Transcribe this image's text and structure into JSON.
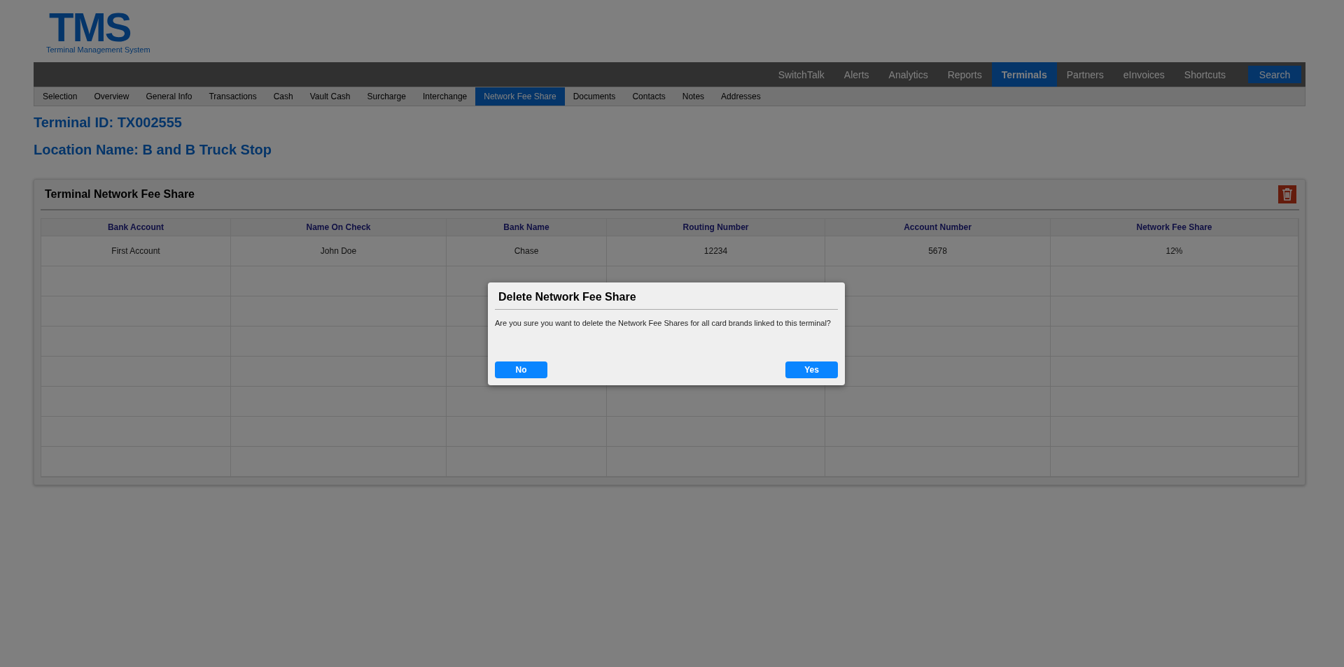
{
  "logo": {
    "mark": "TMS",
    "tagline": "Terminal Management System"
  },
  "main_nav": [
    {
      "label": "SwitchTalk",
      "selected": false
    },
    {
      "label": "Alerts",
      "selected": false
    },
    {
      "label": "Analytics",
      "selected": false
    },
    {
      "label": "Reports",
      "selected": false
    },
    {
      "label": "Terminals",
      "selected": true
    },
    {
      "label": "Partners",
      "selected": false
    },
    {
      "label": "eInvoices",
      "selected": false
    },
    {
      "label": "Shortcuts",
      "selected": false
    }
  ],
  "search_button": "Search",
  "sub_nav": [
    {
      "label": "Selection",
      "selected": false
    },
    {
      "label": "Overview",
      "selected": false
    },
    {
      "label": "General Info",
      "selected": false
    },
    {
      "label": "Transactions",
      "selected": false
    },
    {
      "label": "Cash",
      "selected": false
    },
    {
      "label": "Vault Cash",
      "selected": false
    },
    {
      "label": "Surcharge",
      "selected": false
    },
    {
      "label": "Interchange",
      "selected": false
    },
    {
      "label": "Network Fee Share",
      "selected": true
    },
    {
      "label": "Documents",
      "selected": false
    },
    {
      "label": "Contacts",
      "selected": false
    },
    {
      "label": "Notes",
      "selected": false
    },
    {
      "label": "Addresses",
      "selected": false
    }
  ],
  "terminal_id": "Terminal ID: TX002555",
  "location_name": "Location Name: B and B Truck Stop",
  "panel": {
    "title": "Terminal Network Fee Share",
    "table": {
      "columns": [
        "Bank Account",
        "Name On Check",
        "Bank Name",
        "Routing Number",
        "Account Number",
        "Network Fee Share"
      ],
      "rows": [
        [
          "First Account",
          "John Doe",
          "Chase",
          "12234",
          "5678",
          "12%"
        ]
      ]
    }
  },
  "dialog": {
    "title": "Delete Network Fee Share",
    "message": "Are you sure you want to delete the Network Fee Shares for all card brands linked to this terminal?",
    "buttons": [
      "No",
      "Yes"
    ]
  }
}
